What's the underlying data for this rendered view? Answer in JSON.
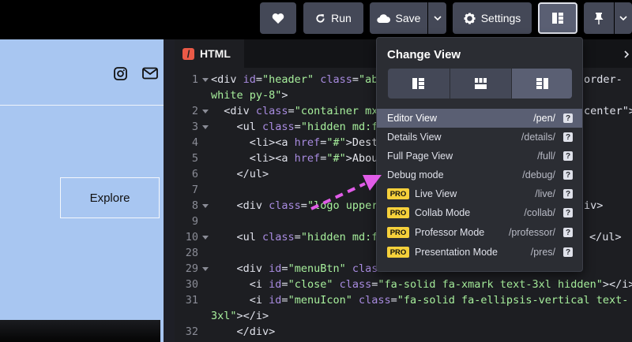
{
  "toolbar": {
    "run_label": "Run",
    "save_label": "Save",
    "settings_label": "Settings"
  },
  "preview": {
    "explore_label": "Explore"
  },
  "editor": {
    "tab_label": "HTML",
    "tab_badge": "/",
    "lines": [
      {
        "n": "1",
        "fold": true,
        "parts": [
          [
            "tg",
            "<div "
          ],
          [
            "at",
            "id"
          ],
          [
            "tg",
            "="
          ],
          [
            "st",
            "\"header\""
          ],
          [
            "tg",
            " "
          ],
          [
            "at",
            "class"
          ],
          [
            "tg",
            "="
          ],
          [
            "st",
            "\"ab"
          ]
        ]
      },
      {
        "n": "",
        "fold": false,
        "parts": [
          [
            "st",
            "white py-8\""
          ],
          [
            "tg",
            ">"
          ]
        ]
      },
      {
        "n": "2",
        "fold": true,
        "parts": [
          [
            "tg",
            "  <div "
          ],
          [
            "at",
            "class"
          ],
          [
            "tg",
            "="
          ],
          [
            "st",
            "\"container mx"
          ]
        ]
      },
      {
        "n": "3",
        "fold": true,
        "parts": [
          [
            "tg",
            "    <ul "
          ],
          [
            "at",
            "class"
          ],
          [
            "tg",
            "="
          ],
          [
            "st",
            "\"hidden md:f"
          ]
        ]
      },
      {
        "n": "4",
        "fold": false,
        "parts": [
          [
            "tg",
            "      <li><a "
          ],
          [
            "at",
            "href"
          ],
          [
            "tg",
            "="
          ],
          [
            "st",
            "\"#\""
          ],
          [
            "tg",
            ">"
          ],
          [
            "tx",
            "Dest"
          ]
        ]
      },
      {
        "n": "5",
        "fold": false,
        "parts": [
          [
            "tg",
            "      <li><a "
          ],
          [
            "at",
            "href"
          ],
          [
            "tg",
            "="
          ],
          [
            "st",
            "\"#\""
          ],
          [
            "tg",
            ">"
          ],
          [
            "tx",
            "Abou"
          ]
        ]
      },
      {
        "n": "6",
        "fold": false,
        "parts": [
          [
            "tg",
            "    </ul>"
          ]
        ]
      },
      {
        "n": "7",
        "fold": false,
        "parts": []
      },
      {
        "n": "8",
        "fold": true,
        "parts": [
          [
            "tg",
            "    <div "
          ],
          [
            "at",
            "class"
          ],
          [
            "tg",
            "="
          ],
          [
            "st",
            "\"logo upper"
          ]
        ]
      },
      {
        "n": "9",
        "fold": false,
        "parts": []
      },
      {
        "n": "10",
        "fold": true,
        "parts": [
          [
            "tg",
            "    <ul "
          ],
          [
            "at",
            "class"
          ],
          [
            "tg",
            "="
          ],
          [
            "st",
            "\"hidden md:f"
          ]
        ]
      },
      {
        "n": "28",
        "fold": false,
        "parts": []
      },
      {
        "n": "29",
        "fold": true,
        "parts": [
          [
            "tg",
            "    <div "
          ],
          [
            "at",
            "id"
          ],
          [
            "tg",
            "="
          ],
          [
            "st",
            "\"menuBtn\""
          ],
          [
            "tg",
            " "
          ],
          [
            "at",
            "clas"
          ]
        ]
      },
      {
        "n": "30",
        "fold": false,
        "parts": [
          [
            "tg",
            "      <i "
          ],
          [
            "at",
            "id"
          ],
          [
            "tg",
            "="
          ],
          [
            "st",
            "\"close\""
          ],
          [
            "tg",
            " "
          ],
          [
            "at",
            "class"
          ],
          [
            "tg",
            "="
          ],
          [
            "st",
            "\"fa-solid fa-xmark text-3xl hidden\""
          ],
          [
            "tg",
            "></i>"
          ]
        ]
      },
      {
        "n": "31",
        "fold": false,
        "parts": [
          [
            "tg",
            "      <i "
          ],
          [
            "at",
            "id"
          ],
          [
            "tg",
            "="
          ],
          [
            "st",
            "\"menuIcon\""
          ],
          [
            "tg",
            " "
          ],
          [
            "at",
            "class"
          ],
          [
            "tg",
            "="
          ],
          [
            "st",
            "\"fa-solid fa-ellipsis-vertical text-"
          ]
        ]
      },
      {
        "n": "",
        "fold": false,
        "parts": [
          [
            "st",
            "3xl\""
          ],
          [
            "tg",
            "></i>"
          ]
        ]
      },
      {
        "n": "32",
        "fold": false,
        "parts": [
          [
            "tg",
            "    </div>"
          ]
        ]
      }
    ],
    "right_fragments": [
      {
        "line": 0,
        "text": "order-"
      },
      {
        "line": 2,
        "text": "center\">"
      },
      {
        "line": 8,
        "text": "iv>"
      },
      {
        "line": 10,
        "text": "</ul>"
      }
    ]
  },
  "change_view": {
    "title": "Change View",
    "items": [
      {
        "label": "Editor View",
        "path": "/pen/",
        "pro": false,
        "selected": true
      },
      {
        "label": "Details View",
        "path": "/details/",
        "pro": false,
        "selected": false
      },
      {
        "label": "Full Page View",
        "path": "/full/",
        "pro": false,
        "selected": false
      },
      {
        "label": "Debug mode",
        "path": "/debug/",
        "pro": false,
        "selected": false
      },
      {
        "label": "Live View",
        "path": "/live/",
        "pro": true,
        "selected": false
      },
      {
        "label": "Collab Mode",
        "path": "/collab/",
        "pro": true,
        "selected": false
      },
      {
        "label": "Professor Mode",
        "path": "/professor/",
        "pro": true,
        "selected": false
      },
      {
        "label": "Presentation Mode",
        "path": "/pres/",
        "pro": true,
        "selected": false
      }
    ],
    "pro_badge": "PRO",
    "help_glyph": "?"
  },
  "colors": {
    "accent_arrow": "#e15ce8",
    "pro_badge": "#f5d03b"
  }
}
